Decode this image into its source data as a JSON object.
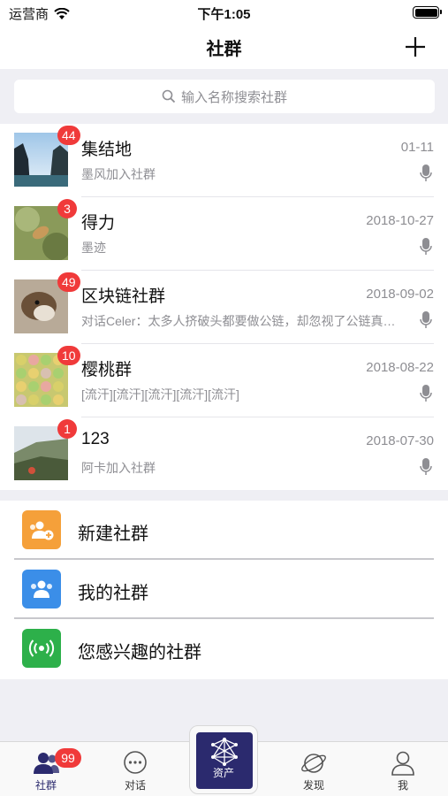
{
  "status_bar": {
    "carrier": "运营商",
    "time": "下午1:05"
  },
  "header": {
    "title": "社群"
  },
  "search": {
    "placeholder": "输入名称搜索社群"
  },
  "communities": [
    {
      "name": "集结地",
      "date": "01-11",
      "subtitle": "墨风加入社群",
      "unread": "44"
    },
    {
      "name": "得力",
      "date": "2018-10-27",
      "subtitle": "墨迹",
      "unread": "3"
    },
    {
      "name": "区块链社群",
      "date": "2018-09-02",
      "subtitle": "对话Celer：太多人挤破头都要做公链，却忽视了公链真正的问题",
      "unread": "49"
    },
    {
      "name": "樱桃群",
      "date": "2018-08-22",
      "subtitle": "[流汗][流汗][流汗][流汗][流汗]",
      "unread": "10"
    },
    {
      "name": "123",
      "date": "2018-07-30",
      "subtitle": "阿卡加入社群",
      "unread": "1"
    }
  ],
  "menu": [
    {
      "label": "新建社群",
      "icon": "add-group-icon",
      "color": "#f5a03a"
    },
    {
      "label": "我的社群",
      "icon": "group-icon",
      "color": "#3b8ee8"
    },
    {
      "label": "您感兴趣的社群",
      "icon": "broadcast-icon",
      "color": "#2db04a"
    }
  ],
  "tabs": [
    {
      "label": "社群",
      "icon": "community-icon",
      "badge": "99",
      "active": true
    },
    {
      "label": "对话",
      "icon": "chat-icon"
    },
    {
      "label": "资产",
      "icon": "asset-network-icon"
    },
    {
      "label": "发现",
      "icon": "planet-icon"
    },
    {
      "label": "我",
      "icon": "profile-icon"
    }
  ],
  "colors": {
    "accent": "#2b2a6e",
    "badge": "#f03a3a",
    "background": "#efeff4"
  }
}
